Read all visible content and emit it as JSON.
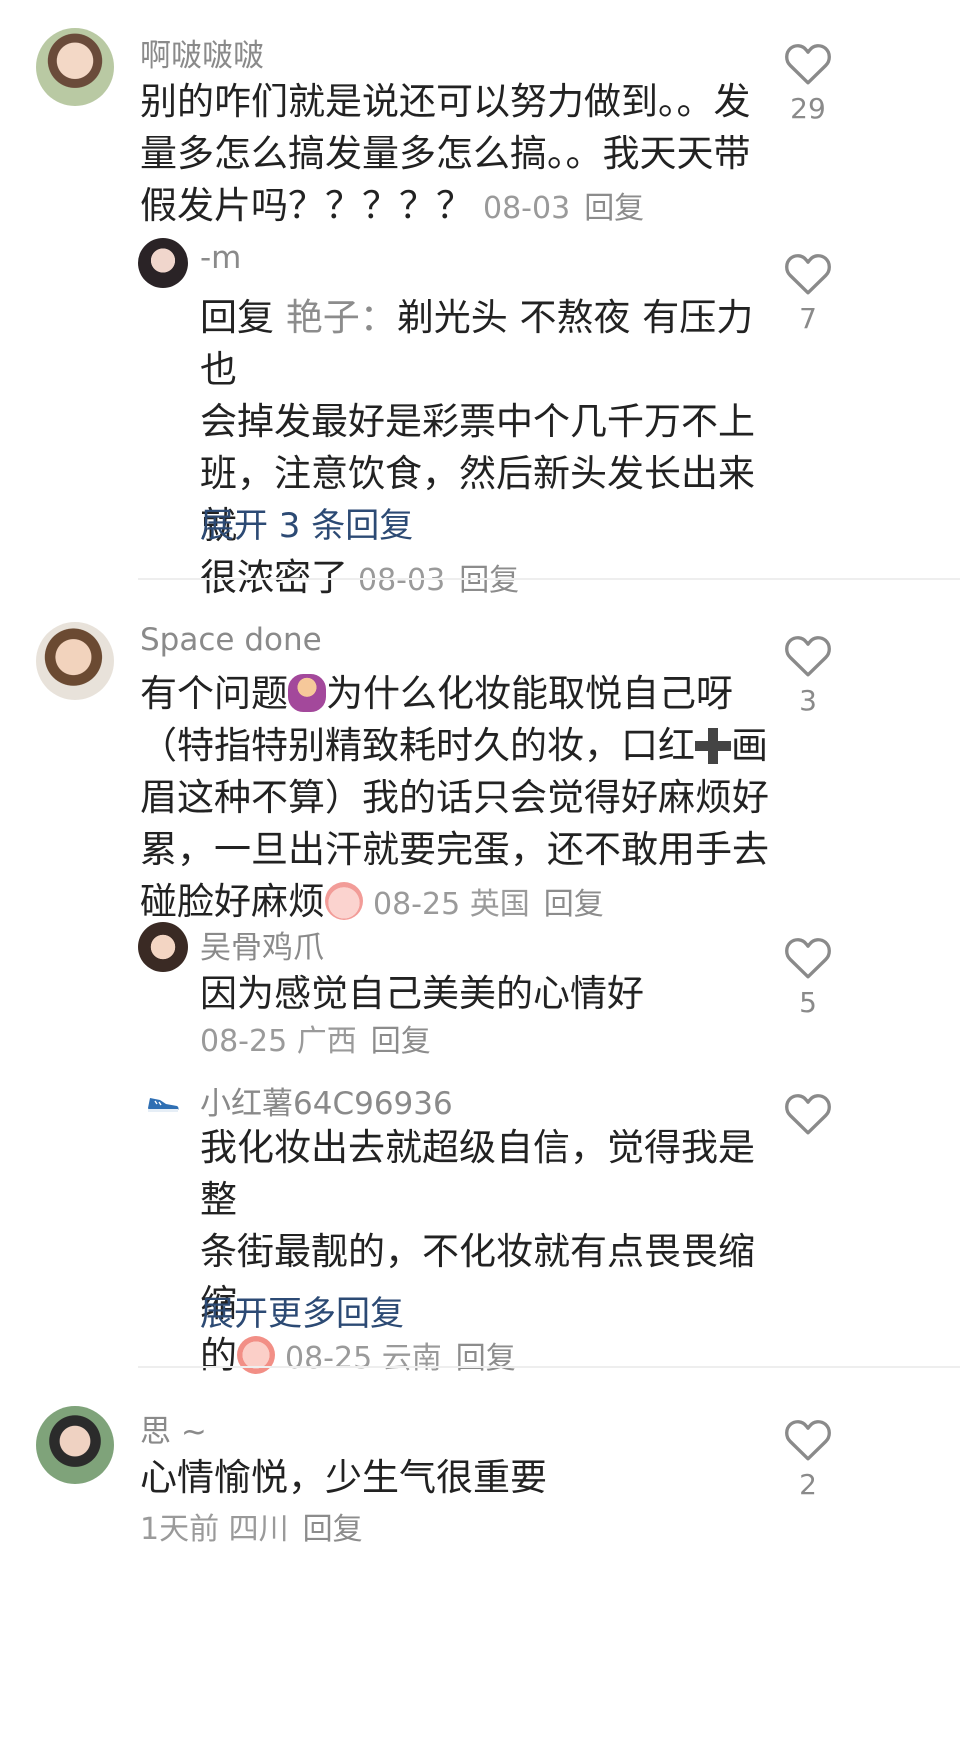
{
  "comments": [
    {
      "username": "啊啵啵啵",
      "lines": [
        "别的咋们就是说还可以努力做到。。发",
        "量多怎么搞发量多怎么搞。。我天天带",
        "假发片吗？？？？？"
      ],
      "date": "08-03",
      "location": "",
      "reply_label": "回复",
      "likes": "29",
      "replies": [
        {
          "username": "-m",
          "reply_prefix": "回复",
          "reply_to": "艳子：",
          "lines": [
            "剃光头 不熬夜 有压力也",
            "会掉发最好是彩票中个几千万不上",
            "班，注意饮食，然后新头发长出来就",
            "很浓密了"
          ],
          "date": "08-03",
          "location": "",
          "reply_label": "回复",
          "likes": "7"
        }
      ],
      "expand_label": "展开 3 条回复"
    },
    {
      "username": "Space done",
      "lines": [
        "有个问题",
        "为什么化妆能取悦自己呀",
        "（特指特别精致耗时久的妆，口红",
        "画",
        "眉这种不算）我的话只会觉得好麻烦好",
        "累，一旦出汗就要完蛋，还不敢用手去",
        "碰脸好麻烦"
      ],
      "date": "08-25",
      "location": "英国",
      "reply_label": "回复",
      "likes": "3",
      "replies": [
        {
          "username": "吴骨鸡爪",
          "lines": [
            "因为感觉自己美美的心情好"
          ],
          "date": "08-25",
          "location": "广西",
          "reply_label": "回复",
          "likes": "5"
        },
        {
          "username": "小红薯64C96936",
          "lines": [
            "我化妆出去就超级自信，觉得我是整",
            "条街最靓的，不化妆就有点畏畏缩缩",
            "的"
          ],
          "date": "08-25",
          "location": "云南",
          "reply_label": "回复",
          "likes": ""
        }
      ],
      "expand_label": "展开更多回复"
    },
    {
      "username": "思 ~",
      "lines": [
        "心情愉悦，少生气很重要"
      ],
      "date": "1天前",
      "location": "四川",
      "reply_label": "回复",
      "likes": "2",
      "replies": []
    }
  ],
  "colors": {
    "text": "#222222",
    "muted": "#8a8a8a",
    "link": "#2c4a74",
    "divider": "#eeeeee"
  },
  "icons": {
    "like": "heart-outline-icon"
  }
}
